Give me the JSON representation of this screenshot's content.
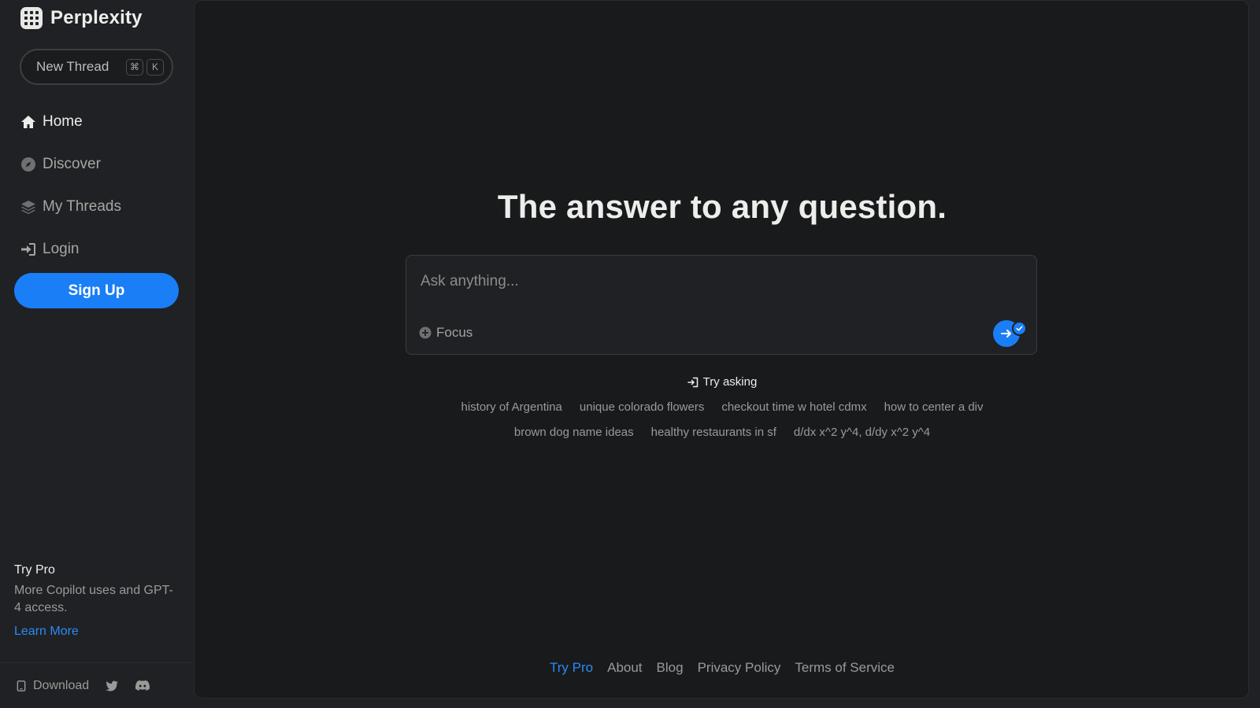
{
  "brand": {
    "name": "Perplexity",
    "icon": "perplexity-logo-icon"
  },
  "sidebar": {
    "new_thread": {
      "label": "New Thread",
      "shortcut_keys": [
        "⌘",
        "K"
      ]
    },
    "nav": [
      {
        "label": "Home",
        "icon": "home-icon",
        "active": true
      },
      {
        "label": "Discover",
        "icon": "compass-icon",
        "active": false
      },
      {
        "label": "My Threads",
        "icon": "layers-icon",
        "active": false
      },
      {
        "label": "Login",
        "icon": "login-icon",
        "active": false
      }
    ],
    "signup_label": "Sign Up",
    "promo": {
      "title": "Try Pro",
      "description": "More Copilot uses and GPT-4 access.",
      "link": "Learn More"
    },
    "footer": {
      "download_label": "Download",
      "icons": [
        "mobile-icon",
        "twitter-icon",
        "discord-icon"
      ]
    }
  },
  "main": {
    "headline": "The answer to any question.",
    "search": {
      "placeholder": "Ask anything...",
      "focus_label": "Focus"
    },
    "try_asking_label": "Try asking",
    "suggestions": [
      "history of Argentina",
      "unique colorado flowers",
      "checkout time w hotel cdmx",
      "how to center a div",
      "brown dog name ideas",
      "healthy restaurants in sf",
      "d/dx x^2 y^4, d/dy x^2 y^4"
    ],
    "footer_links": [
      "Try Pro",
      "About",
      "Blog",
      "Privacy Policy",
      "Terms of Service"
    ]
  },
  "colors": {
    "accent": "#1a7ef6",
    "link": "#2b8af7",
    "sidebar_bg": "#202124",
    "main_bg": "#191a1c"
  }
}
